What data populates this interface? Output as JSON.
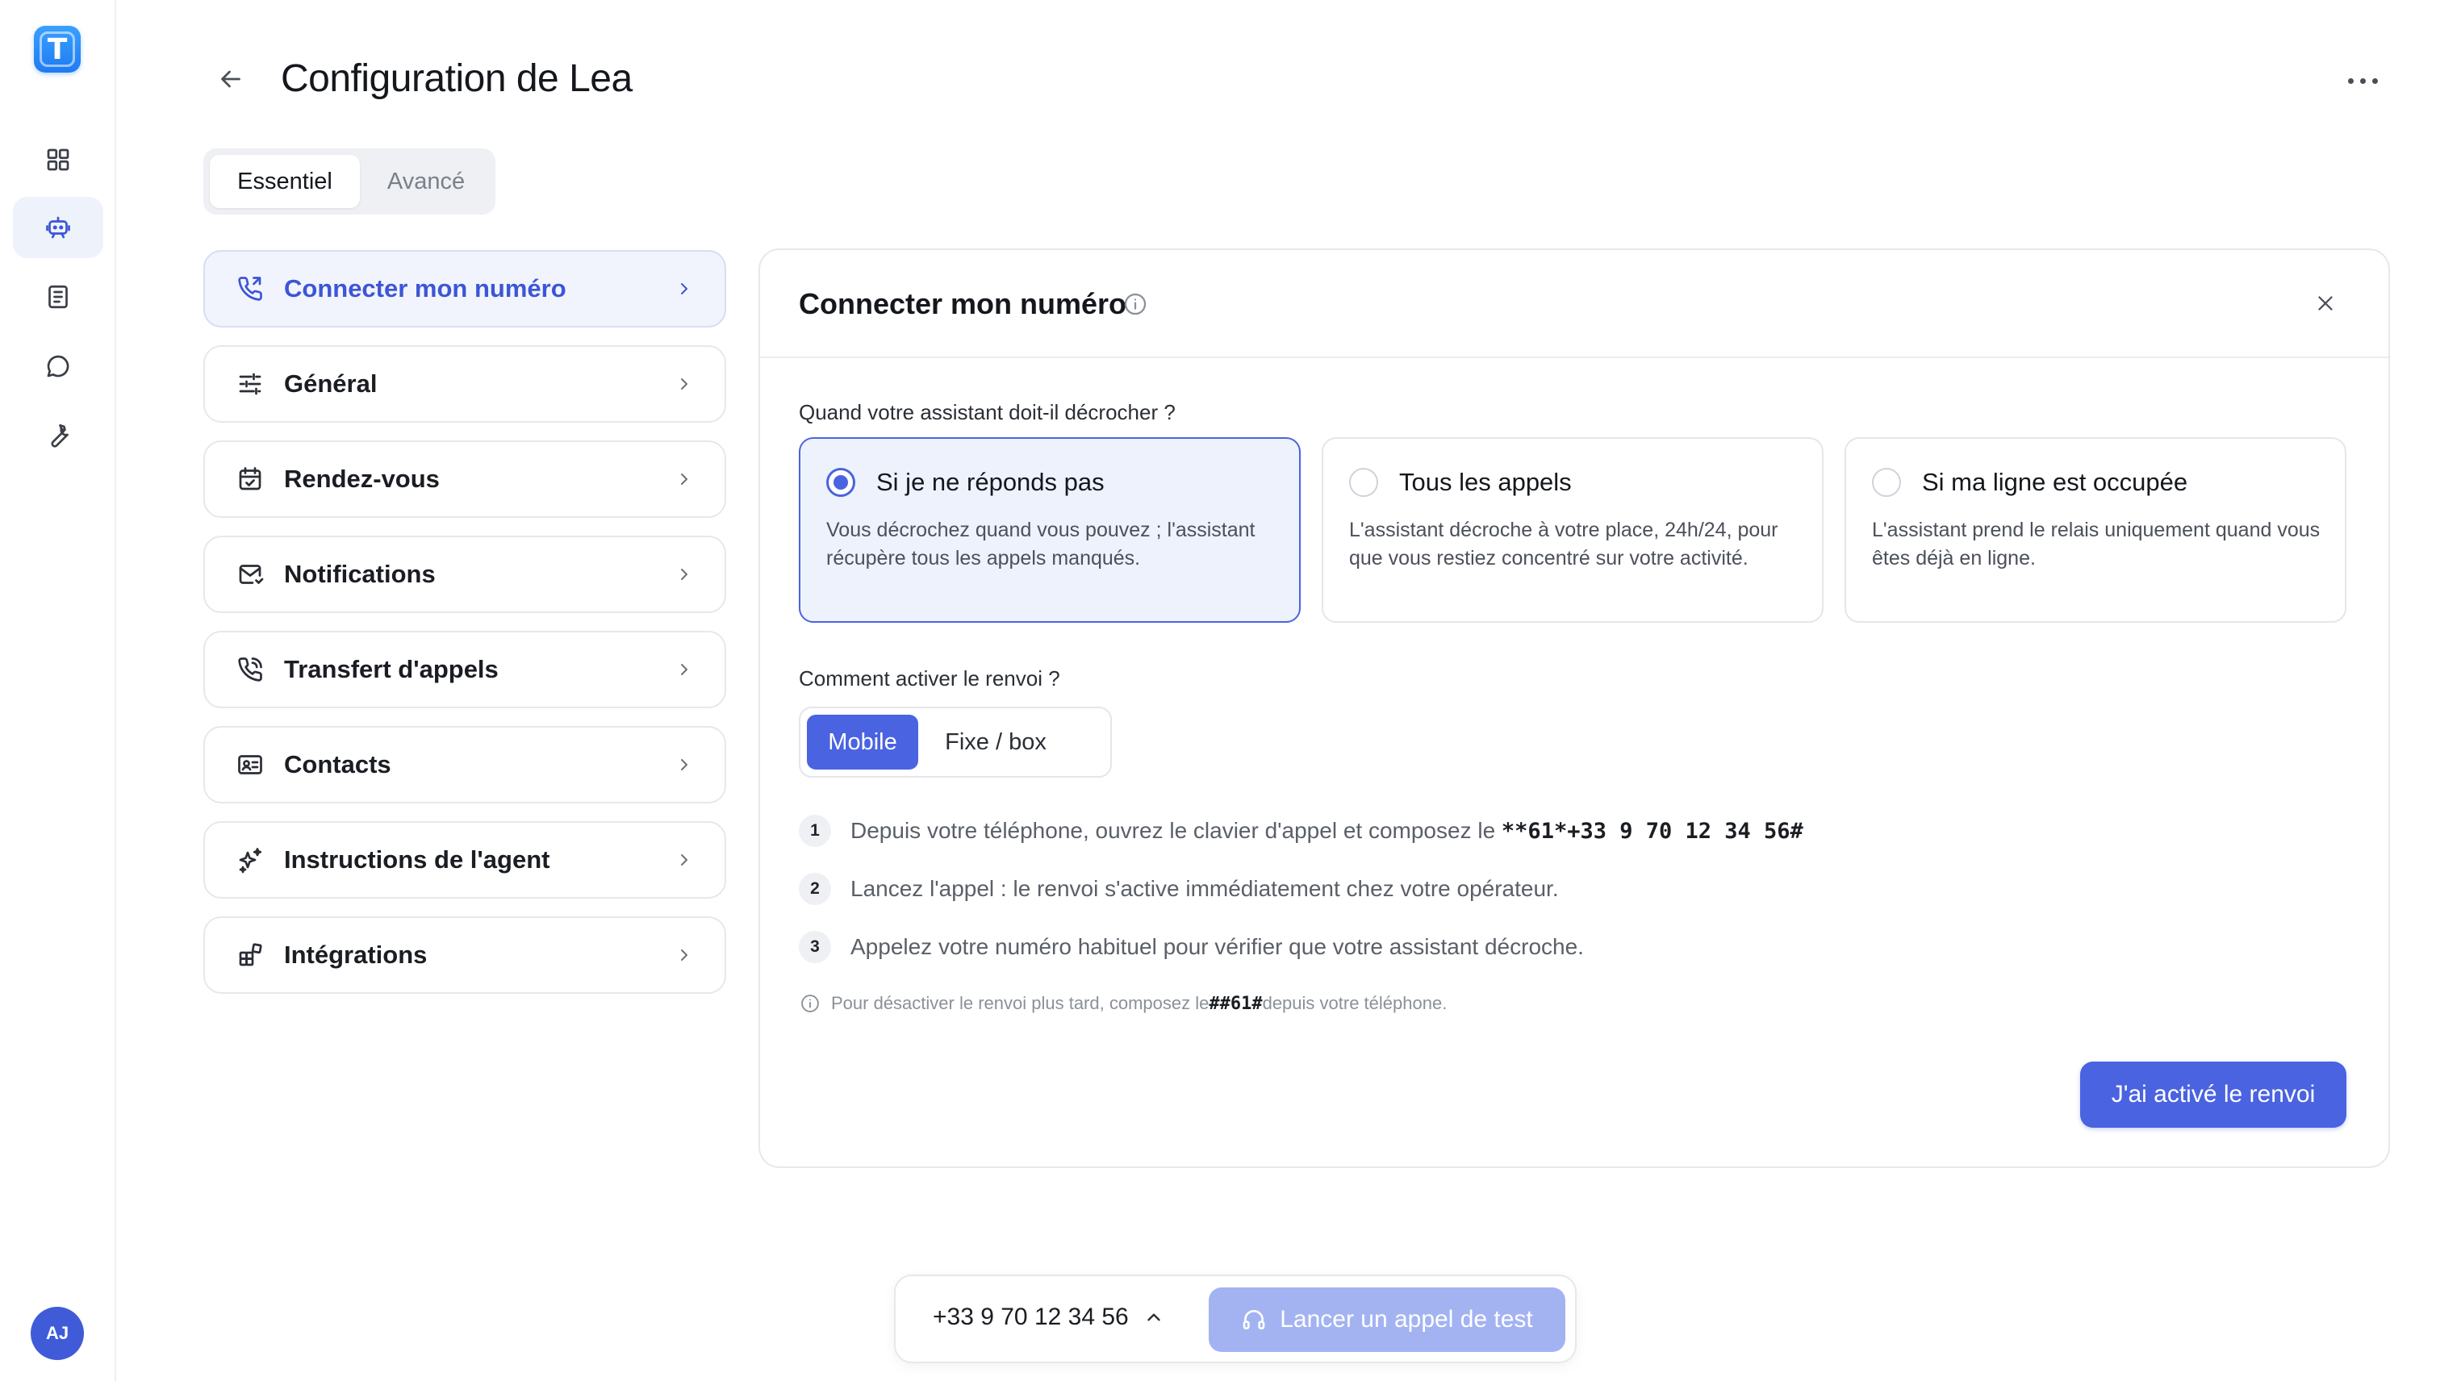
{
  "app": {
    "logo_letter": "T",
    "user_initials": "AJ"
  },
  "colors": {
    "accent": "#4a63e0",
    "accent_light": "#eef2fd",
    "muted_button": "#a3b3f2"
  },
  "sidebar": {
    "items": [
      {
        "icon": "grid-icon",
        "active": false
      },
      {
        "icon": "bot-icon",
        "active": true
      },
      {
        "icon": "notebook-icon",
        "active": false
      },
      {
        "icon": "chat-bubble-icon",
        "active": false
      },
      {
        "icon": "wrench-icon",
        "active": false
      }
    ]
  },
  "header": {
    "title": "Configuration de Lea"
  },
  "tabs": [
    {
      "label": "Essentiel",
      "active": true
    },
    {
      "label": "Avancé",
      "active": false
    }
  ],
  "menu": [
    {
      "label": "Connecter mon numéro",
      "icon": "phone-forward-icon",
      "active": true
    },
    {
      "label": "Général",
      "icon": "sliders-icon",
      "active": false
    },
    {
      "label": "Rendez-vous",
      "icon": "calendar-icon",
      "active": false
    },
    {
      "label": "Notifications",
      "icon": "envelope-icon",
      "active": false
    },
    {
      "label": "Transfert d'appels",
      "icon": "phone-outgoing-icon",
      "active": false
    },
    {
      "label": "Contacts",
      "icon": "contact-card-icon",
      "active": false
    },
    {
      "label": "Instructions de l'agent",
      "icon": "sparkles-icon",
      "active": false
    },
    {
      "label": "Intégrations",
      "icon": "puzzle-icon",
      "active": false
    }
  ],
  "panel": {
    "title": "Connecter mon numéro",
    "question_pickup": "Quand votre assistant doit-il décrocher ?",
    "options": [
      {
        "title": "Si je ne réponds pas",
        "desc": "Vous décrochez quand vous pouvez ; l'assistant récupère tous les appels manqués.",
        "selected": true
      },
      {
        "title": "Tous les appels",
        "desc": "L'assistant décroche à votre place, 24h/24, pour que vous restiez concentré sur votre activité.",
        "selected": false
      },
      {
        "title": "Si ma ligne est occupée",
        "desc": "L'assistant prend le relais uniquement quand vous êtes déjà en ligne.",
        "selected": false
      }
    ],
    "question_forward": "Comment activer le renvoi ?",
    "modes": [
      {
        "label": "Mobile",
        "active": true
      },
      {
        "label": "Fixe / box",
        "active": false
      }
    ],
    "steps": [
      {
        "num": "1",
        "text": "Depuis votre téléphone, ouvrez le clavier d'appel et composez le ",
        "code": "**61*+33 9 70 12 34 56#"
      },
      {
        "num": "2",
        "text": "Lancez l'appel : le renvoi s'active immédiatement chez votre opérateur.",
        "code": ""
      },
      {
        "num": "3",
        "text": "Appelez votre numéro habituel pour vérifier que votre assistant décroche.",
        "code": ""
      }
    ],
    "hint": {
      "before": "Pour désactiver le renvoi plus tard, composez le ",
      "code": "##61#",
      "after": " depuis votre téléphone."
    },
    "confirm_label": "J'ai activé le renvoi"
  },
  "bottom_bar": {
    "phone_number": "+33 9 70 12 34 56",
    "test_call_label": "Lancer un appel de test"
  }
}
